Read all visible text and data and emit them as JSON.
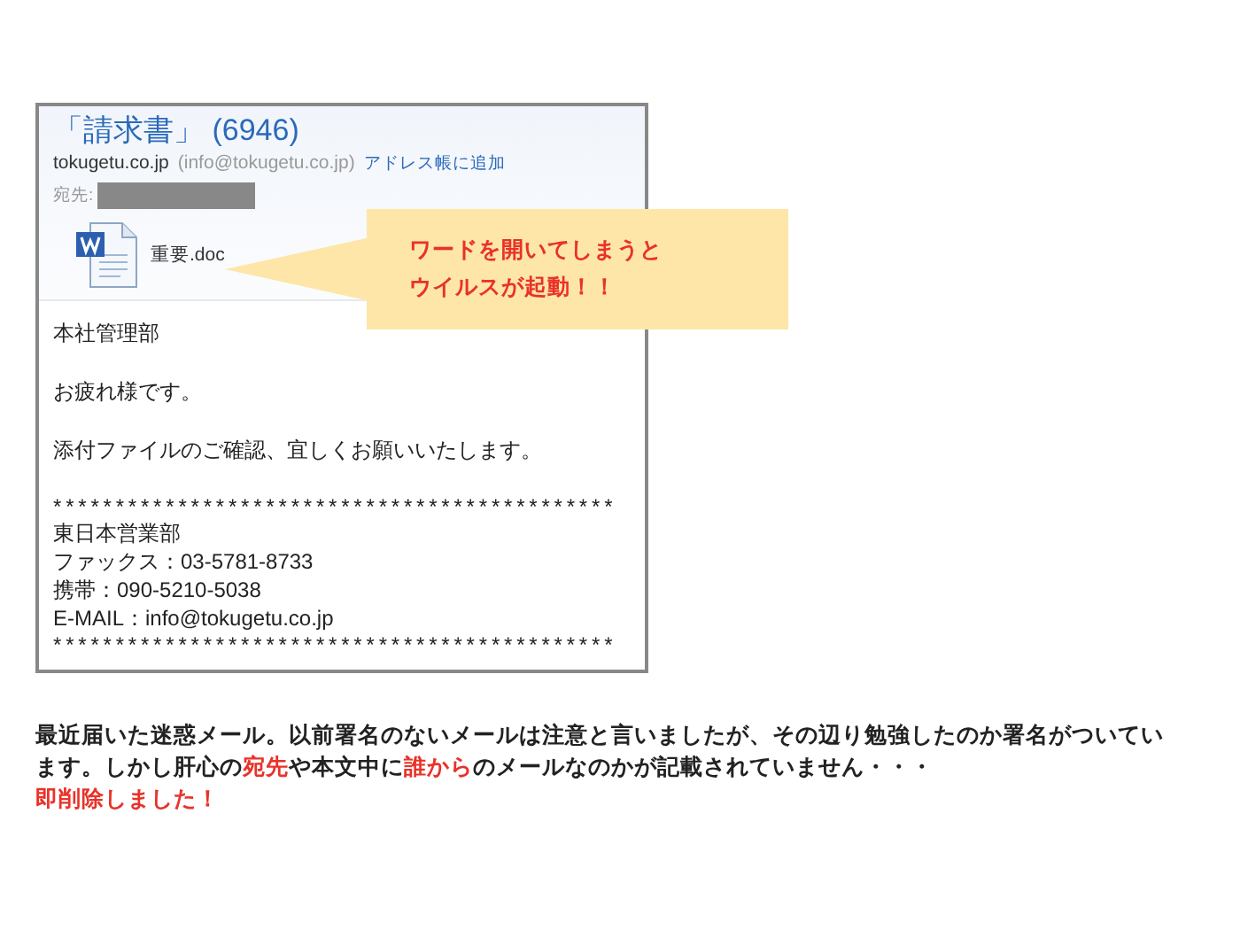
{
  "email": {
    "subject": "「請求書」 (6946)",
    "sender_name": "tokugetu.co.jp",
    "sender_address": "(info@tokugetu.co.jp)",
    "add_contact_link": "アドレス帳に追加",
    "to_label": "宛先:",
    "attachment": {
      "filename": "重要.doc"
    },
    "body_lines": [
      {
        "kind": "paragraph",
        "text": "本社管理部"
      },
      {
        "kind": "paragraph",
        "text": "お疲れ様です。"
      },
      {
        "kind": "paragraph",
        "text": "添付ファイルのご確認、宜しくお願いいたします。"
      },
      {
        "kind": "rule",
        "text": "*********************************************"
      },
      {
        "kind": "signature",
        "text": "東日本営業部"
      },
      {
        "kind": "signature",
        "text": "ファックス：03-5781-8733"
      },
      {
        "kind": "signature",
        "text": "携帯：090-5210-5038"
      },
      {
        "kind": "signature",
        "text": "E-MAIL：info@tokugetu.co.jp"
      },
      {
        "kind": "rule",
        "text": "*********************************************"
      }
    ],
    "callout": {
      "lines": [
        "ワードを開いてしまうと",
        "ウイルスが起動！！"
      ]
    }
  },
  "caption": {
    "segments": [
      {
        "text": "最近届いた迷惑メール。以前署名のないメールは注意と言いましたが、その辺り勉強したのか署名がついています。しかし肝心の",
        "highlight": false
      },
      {
        "text": "宛先",
        "highlight": true
      },
      {
        "text": "や本文中に",
        "highlight": false
      },
      {
        "text": "誰から",
        "highlight": true
      },
      {
        "text": "のメールなのかが記載されていません・・・",
        "highlight": false
      }
    ],
    "conclusion": "即削除しました！"
  }
}
